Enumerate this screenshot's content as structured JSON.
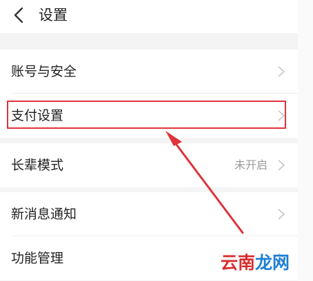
{
  "header": {
    "title": "设置"
  },
  "rows": [
    {
      "label": "账号与安全"
    },
    {
      "label": "支付设置"
    },
    {
      "label": "长辈模式",
      "value": "未开启"
    },
    {
      "label": "新消息通知"
    },
    {
      "label": "功能管理"
    }
  ],
  "watermark": {
    "part1": "云南",
    "part2": "龙网"
  },
  "icons": {
    "back": "chevron-left-icon",
    "row": "chevron-right-icon"
  },
  "colors": {
    "highlight": "#e0323a",
    "annotation_arrow": "#e0323a",
    "watermark_red": "#d92d2d",
    "watermark_blue": "#1c7fd6"
  }
}
